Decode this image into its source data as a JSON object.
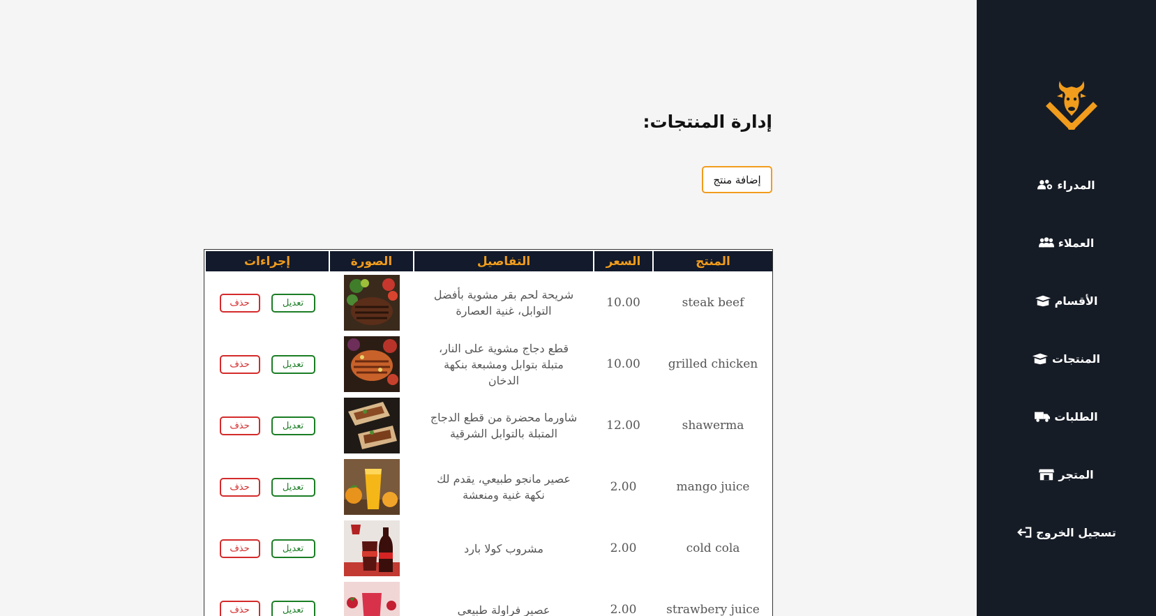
{
  "sidebar": {
    "items": [
      {
        "label": "المدراء",
        "icon": "users-cog-icon"
      },
      {
        "label": "العملاء",
        "icon": "users-icon"
      },
      {
        "label": "الأقسام",
        "icon": "box-open-icon"
      },
      {
        "label": "المنتجات",
        "icon": "box-open-icon"
      },
      {
        "label": "الطلبات",
        "icon": "truck-icon"
      },
      {
        "label": "المتجر",
        "icon": "shop-icon"
      },
      {
        "label": "تسجيل الخروج",
        "icon": "sign-out-icon"
      }
    ],
    "logo_icon": "bull-cleaver-logo"
  },
  "main": {
    "title": "إدارة المنتجات:",
    "add_button": "إضافة منتج"
  },
  "table": {
    "headers": [
      "المنتج",
      "السعر",
      "التفاصيل",
      "الصورة",
      "إجراءات"
    ],
    "edit_label": "تعديل",
    "delete_label": "حذف",
    "rows": [
      {
        "name": "steak beef",
        "price": "10.00",
        "details": "شريحة لحم بقر مشوية بأفضل التوابل، غنية العصارة",
        "image": "steak-image"
      },
      {
        "name": "grilled chicken",
        "price": "10.00",
        "details": "قطع دجاج مشوية على النار، متبلة بتوابل ومشبعة بنكهة الدخان",
        "image": "grilled-chicken-image"
      },
      {
        "name": "shawerma",
        "price": "12.00",
        "details": "شاورما محضرة من قطع الدجاج المتبلة بالتوابل الشرقية",
        "image": "shawerma-image"
      },
      {
        "name": "mango juice",
        "price": "2.00",
        "details": "عصير مانجو طبيعي، يقدم لك نكهة غنية ومنعشة",
        "image": "mango-juice-image"
      },
      {
        "name": "cold cola",
        "price": "2.00",
        "details": "مشروب كولا بارد",
        "image": "cola-image"
      },
      {
        "name": "strawbery juice",
        "price": "2.00",
        "details": "عصير فراولة طبيعي",
        "image": "strawberry-juice-image"
      }
    ]
  },
  "colors": {
    "sidebar_bg": "#161c26",
    "accent": "#f19c1c",
    "header_bg": "#121a2b",
    "edit": "#1a7d24",
    "delete": "#d42a2a"
  }
}
